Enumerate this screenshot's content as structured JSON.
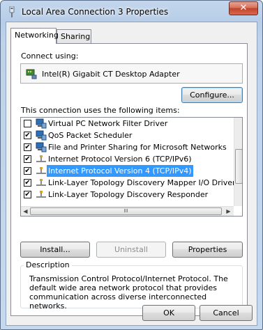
{
  "window": {
    "title": "Local Area Connection 3 Properties",
    "close_label": "✕"
  },
  "tabs": [
    {
      "label": "Networking"
    },
    {
      "label": "Sharing"
    }
  ],
  "connect_using": {
    "label": "Connect using:",
    "adapter": "Intel(R) Gigabit CT Desktop Adapter",
    "configure_label": "Configure..."
  },
  "items": {
    "label": "This connection uses the following items:",
    "list": [
      {
        "label": "Virtual PC Network Filter Driver",
        "checked": false,
        "icon": "network-client-icon"
      },
      {
        "label": "QoS Packet Scheduler",
        "checked": true,
        "icon": "network-service-icon"
      },
      {
        "label": "File and Printer Sharing for Microsoft Networks",
        "checked": true,
        "icon": "network-service-icon"
      },
      {
        "label": "Internet Protocol Version 6 (TCP/IPv6)",
        "checked": true,
        "icon": "protocol-icon"
      },
      {
        "label": "Internet Protocol Version 4 (TCP/IPv4)",
        "checked": true,
        "icon": "protocol-icon",
        "selected": true
      },
      {
        "label": "Link-Layer Topology Discovery Mapper I/O Driver",
        "checked": true,
        "icon": "protocol-icon"
      },
      {
        "label": "Link-Layer Topology Discovery Responder",
        "checked": true,
        "icon": "protocol-icon"
      }
    ],
    "scroll_grip": "III",
    "check_mark": "✔"
  },
  "buttons": {
    "install": "Install...",
    "uninstall": "Uninstall",
    "properties": "Properties",
    "ok": "OK",
    "cancel": "Cancel"
  },
  "description": {
    "title": "Description",
    "text": "Transmission Control Protocol/Internet Protocol. The default wide area network protocol that provides communication across diverse interconnected networks."
  },
  "colors": {
    "selection": "#3399ff",
    "close": "#c3432c"
  }
}
